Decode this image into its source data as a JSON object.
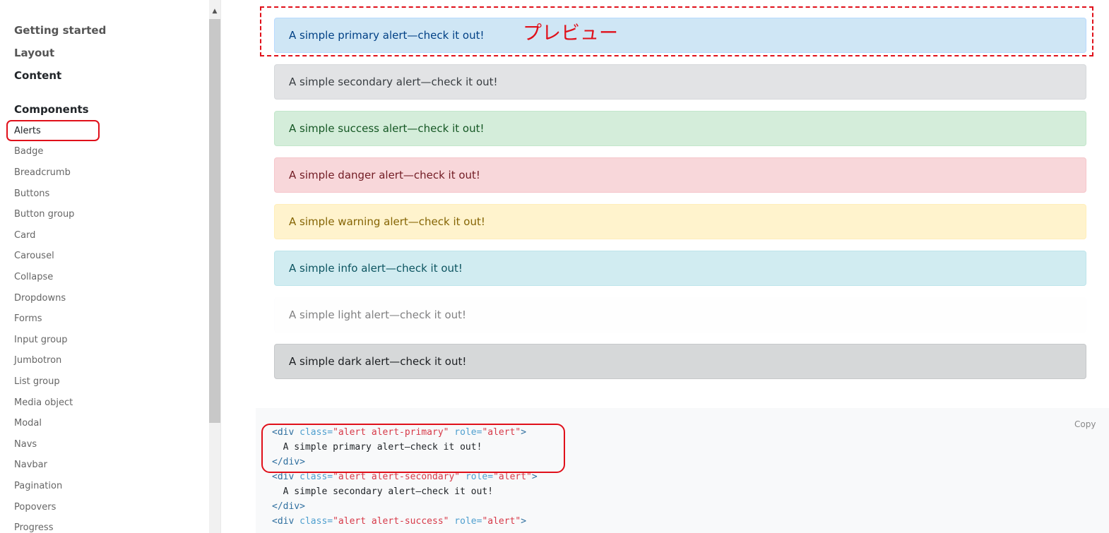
{
  "sidebar": {
    "sections": [
      "Getting started",
      "Layout",
      "Content",
      "Components"
    ],
    "items": [
      "Alerts",
      "Badge",
      "Breadcrumb",
      "Buttons",
      "Button group",
      "Card",
      "Carousel",
      "Collapse",
      "Dropdowns",
      "Forms",
      "Input group",
      "Jumbotron",
      "List group",
      "Media object",
      "Modal",
      "Navs",
      "Navbar",
      "Pagination",
      "Popovers",
      "Progress"
    ]
  },
  "alerts": [
    {
      "type": "primary",
      "text": "A simple primary alert—check it out!"
    },
    {
      "type": "secondary",
      "text": "A simple secondary alert—check it out!"
    },
    {
      "type": "success",
      "text": "A simple success alert—check it out!"
    },
    {
      "type": "danger",
      "text": "A simple danger alert—check it out!"
    },
    {
      "type": "warning",
      "text": "A simple warning alert—check it out!"
    },
    {
      "type": "info",
      "text": "A simple info alert—check it out!"
    },
    {
      "type": "light",
      "text": "A simple light alert—check it out!"
    },
    {
      "type": "dark",
      "text": "A simple dark alert—check it out!"
    }
  ],
  "preview_label": "プレビュー",
  "code": {
    "copy_label": "Copy",
    "lines": [
      {
        "open": "<div",
        "attr_class": " class=",
        "class_val": "\"alert alert-primary\"",
        "attr_role": " role=",
        "role_val": "\"alert\"",
        "close": ">"
      },
      {
        "text": "  A simple primary alert—check it out!"
      },
      {
        "tag": "</div>"
      },
      {
        "open": "<div",
        "attr_class": " class=",
        "class_val": "\"alert alert-secondary\"",
        "attr_role": " role=",
        "role_val": "\"alert\"",
        "close": ">"
      },
      {
        "text": "  A simple secondary alert—check it out!"
      },
      {
        "tag": "</div>"
      },
      {
        "open": "<div",
        "attr_class": " class=",
        "class_val": "\"alert alert-success\"",
        "attr_role": " role=",
        "role_val": "\"alert\"",
        "close": ">"
      }
    ]
  },
  "colors": {
    "annotation_red": "#e0101a",
    "alert_primary_bg": "#cfe6f5",
    "alert_secondary_bg": "#e2e3e5",
    "alert_success_bg": "#d4edda",
    "alert_danger_bg": "#f8d7da",
    "alert_warning_bg": "#fff3cd",
    "alert_info_bg": "#d1ecf1",
    "alert_dark_bg": "#d6d8d9"
  }
}
